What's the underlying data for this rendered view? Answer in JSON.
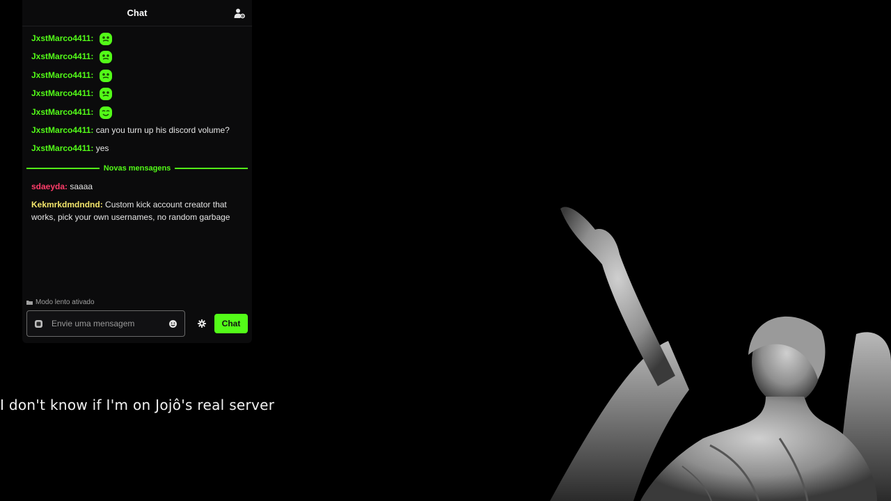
{
  "chat": {
    "title": "Chat",
    "header_icon": "user-settings-icon",
    "colors": {
      "accent": "#53fc18",
      "username_green": "#53fc18",
      "username_red": "#ff3d6a",
      "username_yellow": "#f5e66b"
    },
    "messages": [
      {
        "user": "JxstMarco4411",
        "text": "",
        "emote": "green-blob-emote"
      },
      {
        "user": "JxstMarco4411",
        "text": "",
        "emote": "green-blob-emote"
      },
      {
        "user": "JxstMarco4411",
        "text": "",
        "emote": "green-blob-emote"
      },
      {
        "user": "JxstMarco4411",
        "text": "",
        "emote": "green-blob-emote"
      },
      {
        "user": "JxstMarco4411",
        "text": "",
        "emote": "green-blob-smile-emote"
      },
      {
        "user": "JxstMarco4411",
        "text": "can you turn up his discord volume?"
      },
      {
        "user": "JxstMarco4411",
        "text": "yes"
      }
    ],
    "divider_label": "Novas mensagens",
    "new_messages": [
      {
        "user": "sdaeyda",
        "text": "saaaa"
      },
      {
        "user": "Kekmrkdmdndnd",
        "text": "Custom kick account creator that works, pick your own usernames, no random garbage"
      }
    ],
    "slow_mode": "Modo lento ativado",
    "input": {
      "placeholder": "Envie uma mensagem",
      "value": ""
    },
    "send_label": "Chat"
  },
  "subtitle": "I don't know if I'm on Jojô's real server"
}
